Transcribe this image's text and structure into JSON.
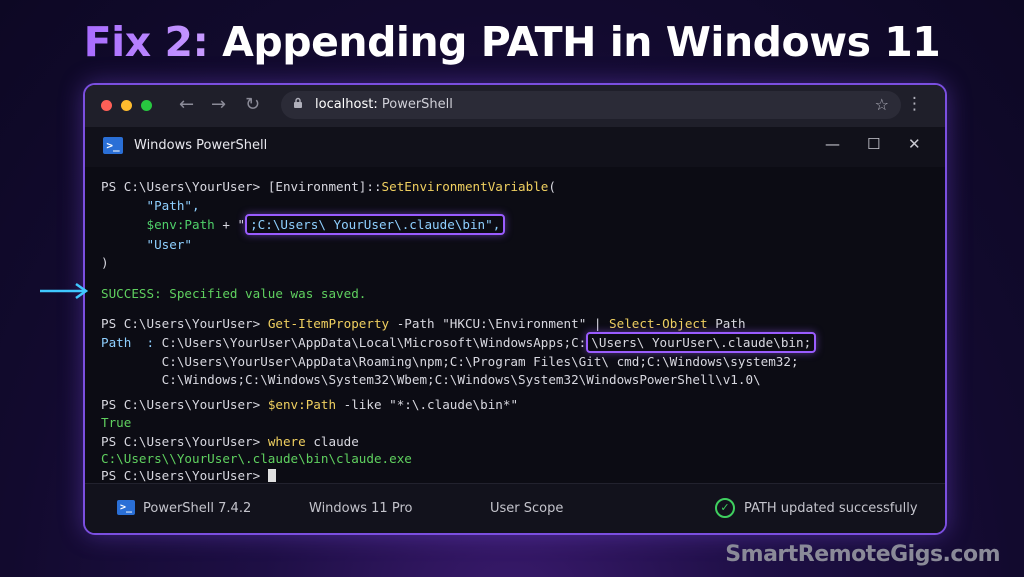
{
  "headline": {
    "prefix": "Fix 2:",
    "rest": " Appending PATH in Windows 11"
  },
  "browser": {
    "address_host": "localhost:",
    "address_page": " PowerShell",
    "back": "←",
    "forward": "→",
    "reload": "↻",
    "star": "☆",
    "menu": "⋮",
    "lock": "🔒"
  },
  "window": {
    "title": "Windows PowerShell",
    "minimize": "—",
    "maximize": "☐",
    "close": "✕"
  },
  "terminal": {
    "l1_prompt": "PS C:\\Users\\YourUser> ",
    "l1_cmd": "[Environment]::",
    "l1_method": "SetEnvironmentVariable",
    "l1_open": "(",
    "l2": "      \"Path\",",
    "l3_var": "      $env:Path",
    "l3_plus": " + \"",
    "l3_hl": ";C:\\Users\\ YourUser\\.claude\\bin\",",
    "l4": "      \"User\"",
    "l5": ")",
    "success": "SUCCESS: Specified value was saved.",
    "l7_prompt": "PS C:\\Users\\YourUser> ",
    "l7_cmd": "Get-ItemProperty",
    "l7_args": " -Path \"HKCU:\\Environment\" | ",
    "l7_cmd2": "Select-Object",
    "l7_args2": " Path",
    "l8_label": "Path  : ",
    "l8_text": "C:\\Users\\YourUser\\AppData\\Local\\Microsoft\\WindowsApps;C:",
    "l8_hl": "\\Users\\ YourUser\\.claude\\bin;",
    "l9": "        C:\\Users\\YourUser\\AppData\\Roaming\\npm;C:\\Program Files\\Git\\ cmd;C:\\Windows\\system32;",
    "l10": "        C:\\Windows;C:\\Windows\\System32\\Wbem;C:\\Windows\\System32\\WindowsPowerShell\\v1.0\\",
    "l11_prompt": "PS C:\\Users\\YourUser> ",
    "l11_var": "$env:Path",
    "l11_args": " -like \"*:\\.claude\\bin*\"",
    "l12": "True",
    "l13_prompt": "PS C:\\Users\\YourUser> ",
    "l13_cmd": "where",
    "l13_args": " claude",
    "l14": "C:\\Users\\\\YourUser\\.claude\\bin\\claude.exe",
    "l15_prompt": "PS C:\\Users\\YourUser> "
  },
  "status": {
    "ps_version": "PowerShell 7.4.2",
    "os": "Windows 11 Pro",
    "scope": "User Scope",
    "result": "PATH updated successfully",
    "check": "✓"
  },
  "watermark": "SmartRemoteGigs.com",
  "colors": {
    "accent": "#9a5cff",
    "success": "#4fd06a",
    "keyword": "#f0d060",
    "string": "#8fd0ff"
  }
}
